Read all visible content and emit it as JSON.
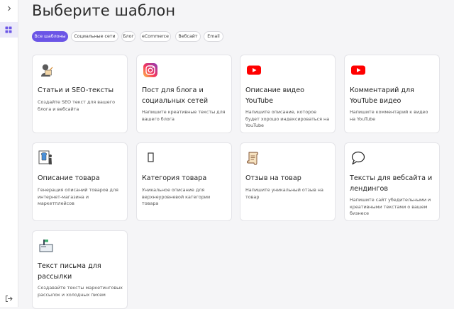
{
  "page": {
    "title": "Выберите шаблон"
  },
  "filters": [
    {
      "label": "Все шаблоны",
      "active": true
    },
    {
      "label": "Социальные сети",
      "active": false
    },
    {
      "label": "Блог",
      "active": false
    },
    {
      "label": "eCommerce",
      "active": false
    },
    {
      "label": "Вебсайт",
      "active": false
    },
    {
      "label": "Email",
      "active": false
    }
  ],
  "cards": [
    {
      "title": "Статьи и SEO-тексты",
      "desc": "Создайте SEO текст для вашего блога и вебсайта",
      "icon": "writer-icon"
    },
    {
      "title": "Пост для блога и социальных сетей",
      "desc": "Напишите креативные тексты для вашего блога",
      "icon": "instagram-icon"
    },
    {
      "title": "Описание видео YouTube",
      "desc": "Напишите описание, которое будет хорошо индексироваться на YouTube",
      "icon": "youtube-icon"
    },
    {
      "title": "Комментарий для YouTube видео",
      "desc": "Напишите комментарий к видео на YouTube",
      "icon": "youtube-icon"
    },
    {
      "title": "Описание товара",
      "desc": "Генерация описаний товаров для интернет-магазина и маркетплейсов",
      "icon": "product-icon"
    },
    {
      "title": "Категория товара",
      "desc": "Уникальное описание для верхнеуровневой категории товара",
      "icon": "category-icon"
    },
    {
      "title": "Отзыв на товар",
      "desc": "Напишите уникальный отзыв на товар",
      "icon": "scroll-icon"
    },
    {
      "title": "Тексты для вебсайта и лендингов",
      "desc": "Напишите сайт убедительными и креативными текстами о вашем бизнесе",
      "icon": "speech-bubble-icon"
    },
    {
      "title": "Текст письма для рассылки",
      "desc": "Создавайте тексты маркетинговых рассылок и холодных писем",
      "icon": "mailbox-icon"
    }
  ],
  "colors": {
    "accent": "#6b55e6",
    "youtube": "#ff0000"
  }
}
